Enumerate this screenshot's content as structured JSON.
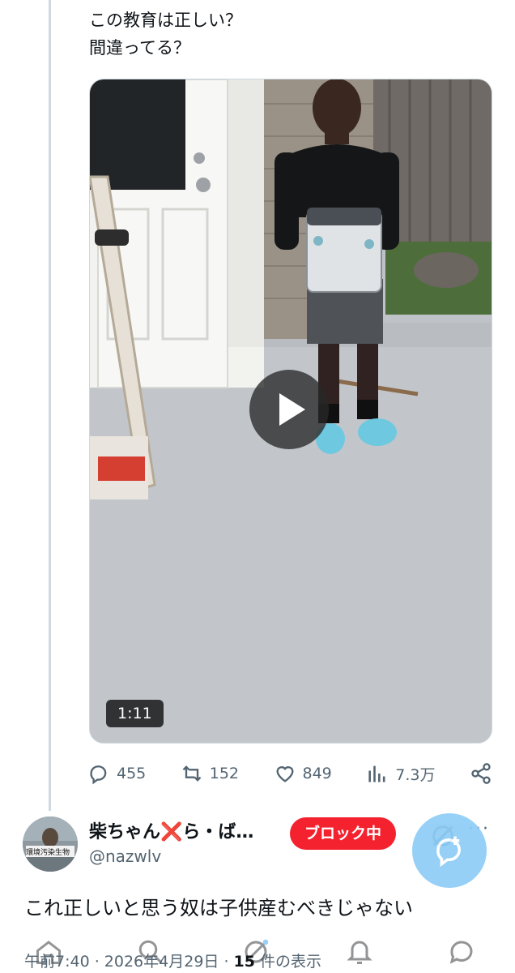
{
  "post": {
    "text_line1": "この教育は正しい？",
    "text_line2": "間違ってる？",
    "video_duration": "1:11",
    "stats": {
      "replies": "455",
      "reposts": "152",
      "likes": "849",
      "views": "7.3万"
    }
  },
  "reply": {
    "display_name": "柴ちゃん",
    "name_mark": "❌",
    "name_rest": "ら・ば…",
    "handle": "@nazwlv",
    "avatar_caption": "環境汚染生物",
    "block_badge": "ブロック中",
    "text": "これ正しいと思う奴は子供産むべきじゃない"
  },
  "meta": {
    "time_date": "午前7:40 · 2026年4月29日 · ",
    "count": "15",
    "count_suffix": " 件の表示"
  },
  "icons": {
    "reply": "speech-bubble-icon",
    "repost": "repost-arrows-icon",
    "like": "heart-icon",
    "views": "bar-chart-icon",
    "share": "share-icon",
    "grok": "grok-icon",
    "more": "more-dots-icon",
    "fab": "compose-reply-icon",
    "nav": [
      "home-icon",
      "search-icon",
      "grok-icon",
      "notifications-icon",
      "messages-icon"
    ]
  },
  "colors": {
    "accent": "#1d9bf0",
    "block_red": "#f4212e",
    "muted": "#536471"
  }
}
